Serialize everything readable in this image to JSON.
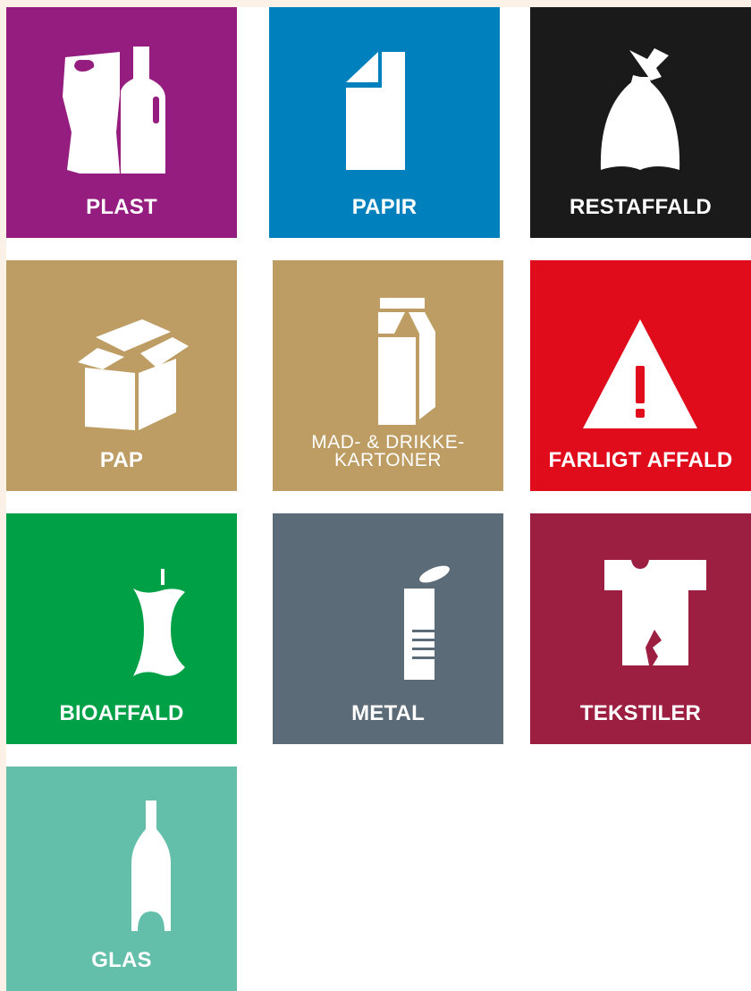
{
  "tiles": [
    {
      "label": "PLAST",
      "color": "#951d7f",
      "icon": "plastic-bag-bottle-icon"
    },
    {
      "label": "PAPIR",
      "color": "#0081be",
      "icon": "paper-sheet-icon"
    },
    {
      "label": "RESTAFFALD",
      "color": "#1a1a1a",
      "icon": "trash-bag-icon"
    },
    {
      "label": "PAP",
      "color": "#bd9d63",
      "icon": "cardboard-box-icon"
    },
    {
      "label": "MAD- & DRIKKE-\nKARTONER",
      "color": "#bd9d63",
      "icon": "milk-carton-icon"
    },
    {
      "label": "FARLIGT AFFALD",
      "color": "#e00c1b",
      "icon": "warning-triangle-icon"
    },
    {
      "label": "BIOAFFALD",
      "color": "#00a047",
      "icon": "apple-core-icon"
    },
    {
      "label": "METAL",
      "color": "#5b6b77",
      "icon": "tin-can-icon"
    },
    {
      "label": "TEKSTILER",
      "color": "#9c1e41",
      "icon": "t-shirt-icon"
    },
    {
      "label": "GLAS",
      "color": "#63bfa9",
      "icon": "glass-bottle-icon"
    }
  ]
}
